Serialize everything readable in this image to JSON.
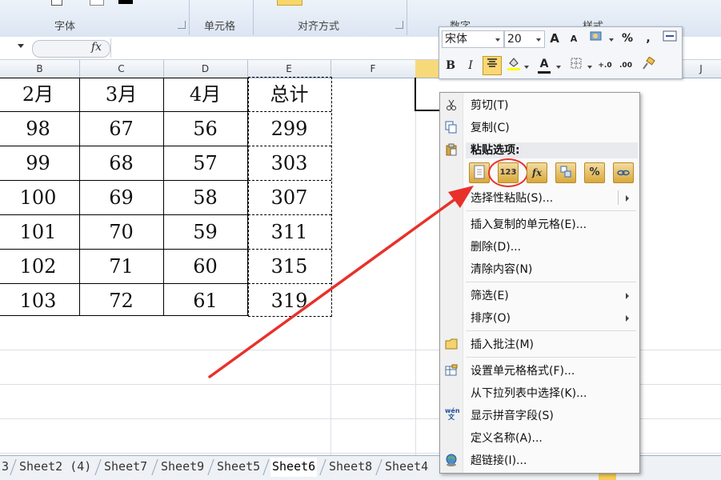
{
  "ribbon": {
    "groups": [
      "字体",
      "单元格",
      "对齐方式",
      "数字",
      "样式"
    ]
  },
  "formula_bar": {
    "fx": "fx",
    "value": ""
  },
  "columns": [
    "B",
    "C",
    "D",
    "E",
    "F",
    "J"
  ],
  "table": {
    "header": [
      "2月",
      "3月",
      "4月",
      "总计"
    ],
    "rows": [
      [
        "98",
        "67",
        "56",
        "299"
      ],
      [
        "99",
        "68",
        "57",
        "303"
      ],
      [
        "100",
        "69",
        "58",
        "307"
      ],
      [
        "101",
        "70",
        "59",
        "311"
      ],
      [
        "102",
        "71",
        "60",
        "315"
      ],
      [
        "103",
        "72",
        "61",
        "319"
      ]
    ]
  },
  "sheet_tabs": {
    "items": [
      "3",
      "Sheet2 (4)",
      "Sheet7",
      "Sheet9",
      "Sheet5",
      "Sheet6",
      "Sheet8",
      "Sheet4"
    ],
    "active": "Sheet6"
  },
  "mini_toolbar": {
    "font": "宋体",
    "size": "20",
    "grow_label": "A",
    "shrink_label": "A",
    "percent_label": "%",
    "comma_label": ",",
    "bold_label": "B",
    "italic_label": "I",
    "font_color_label": "A",
    "inc_decimal_label": "+.0",
    "dec_decimal_label": ".00",
    "accent_color": "#e8312b"
  },
  "context_menu": {
    "cut": "剪切(T)",
    "copy": "复制(C)",
    "paste_options_header": "粘贴选项:",
    "paste_values_label": "123",
    "paste_formula_label": "fx",
    "paste_percent_label": "%",
    "paste_special": "选择性粘贴(S)...",
    "insert_copied": "插入复制的单元格(E)...",
    "delete": "删除(D)...",
    "clear": "清除内容(N)",
    "filter": "筛选(E)",
    "sort": "排序(O)",
    "insert_comment": "插入批注(M)",
    "format_cells": "设置单元格格式(F)...",
    "pick_from_list": "从下拉列表中选择(K)...",
    "show_phonetic": "显示拼音字段(S)",
    "define_name": "定义名称(A)...",
    "hyperlink": "超链接(I)...",
    "phonetic_icon_text": "wén 文"
  },
  "highlight_color": "#e8312b"
}
